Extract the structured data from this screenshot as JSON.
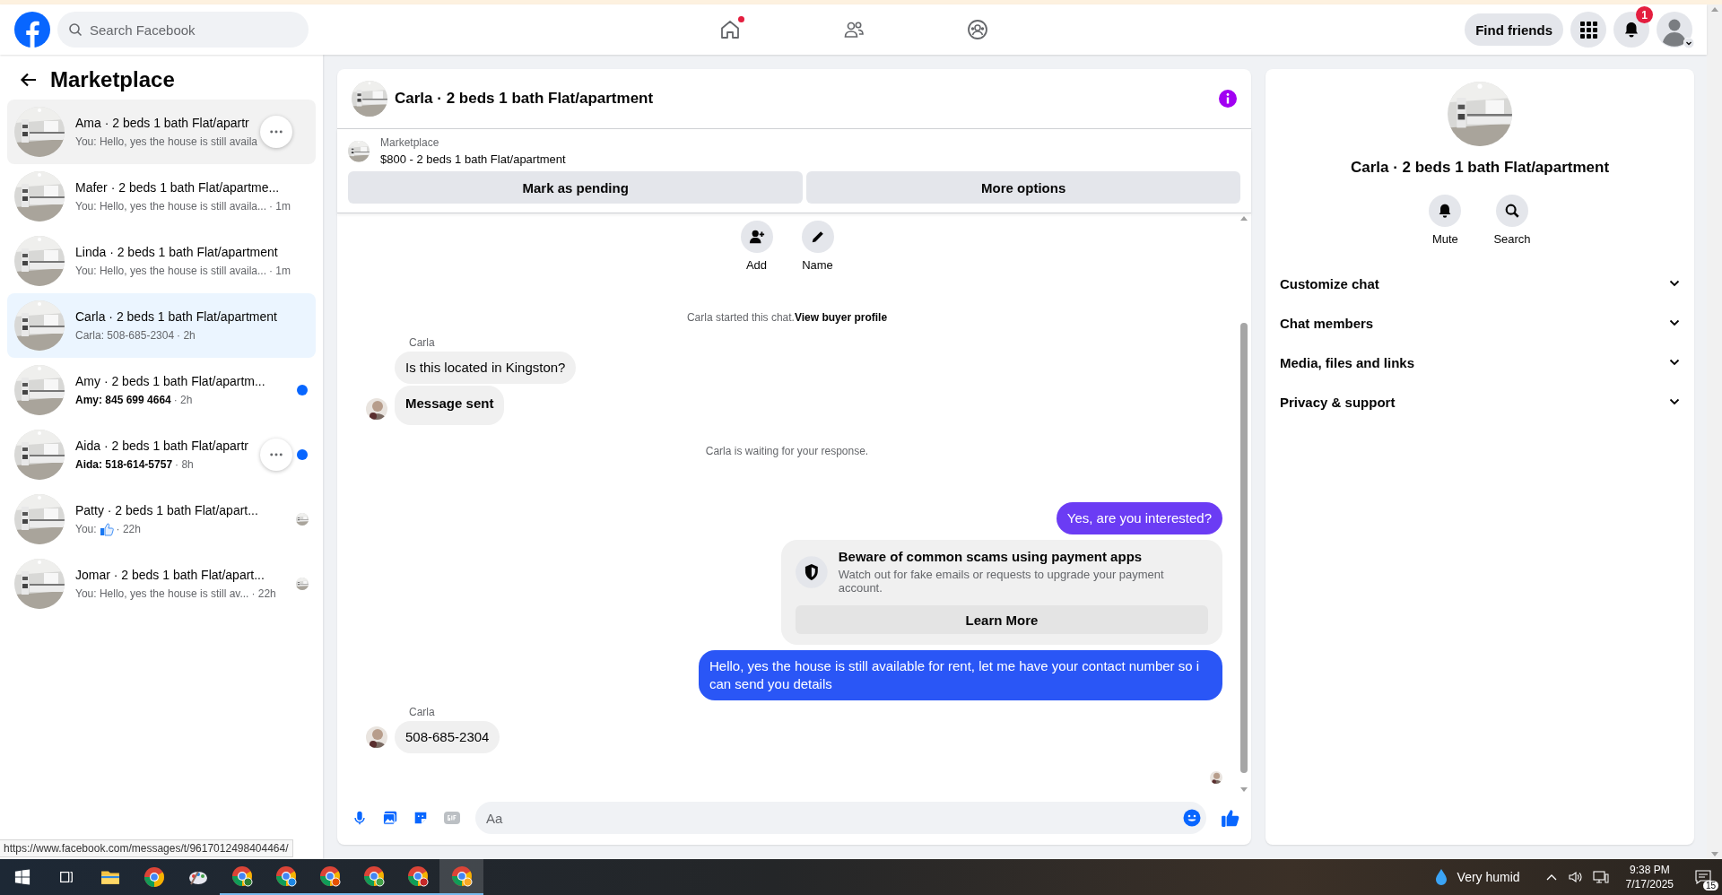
{
  "navbar": {
    "search": {
      "placeholder": "Search Facebook"
    },
    "nav_icons": [
      {
        "kind": "home",
        "notification_dot": true
      },
      {
        "kind": "friends",
        "notification_dot": false
      },
      {
        "kind": "groups",
        "notification_dot": false
      }
    ],
    "find_friends": "Find friends",
    "notifications_badge": "1"
  },
  "sidebar": {
    "title": "Marketplace",
    "conversations": [
      {
        "title": "Ama · 2 beds 1 bath Flat/apartr",
        "preview": "You: Hello, yes the house is still availa",
        "selected": false,
        "hovered": true,
        "unread": false,
        "more_button": true,
        "seen": false,
        "like_icon": false
      },
      {
        "title": "Mafer · 2 beds 1 bath Flat/apartme...",
        "preview": "You: Hello, yes the house is still availa...",
        "time": "· 1m",
        "selected": false,
        "hovered": false,
        "unread": false,
        "more_button": false,
        "seen": false,
        "like_icon": false
      },
      {
        "title": "Linda · 2 beds 1 bath Flat/apartment",
        "preview": "You: Hello, yes the house is still availa...",
        "time": "· 1m",
        "selected": false,
        "hovered": false,
        "unread": false,
        "more_button": false,
        "seen": false,
        "like_icon": false
      },
      {
        "title": "Carla · 2 beds 1 bath Flat/apartment",
        "preview": "Carla: 508-685-2304",
        "time": "· 2h",
        "selected": true,
        "hovered": false,
        "unread": false,
        "more_button": false,
        "seen": false,
        "like_icon": false
      },
      {
        "title": "Amy · 2 beds 1 bath Flat/apartm...",
        "preview": "Amy: 845 699 4664",
        "time": "· 2h",
        "selected": false,
        "hovered": false,
        "unread": true,
        "more_button": false,
        "seen": false,
        "like_icon": false
      },
      {
        "title": "Aida · 2 beds 1 bath Flat/apartr",
        "preview": "Aida: 518-614-5757",
        "time": "· 8h",
        "selected": false,
        "hovered": false,
        "unread": true,
        "more_button": true,
        "seen": false,
        "like_icon": false
      },
      {
        "title": "Patty · 2 beds 1 bath Flat/apart...",
        "preview": "You:",
        "time": "· 22h",
        "selected": false,
        "hovered": false,
        "unread": false,
        "more_button": false,
        "seen": true,
        "like_icon": true
      },
      {
        "title": "Jomar · 2 beds 1 bath Flat/apart...",
        "preview": "You: Hello, yes the house is still av...",
        "time": "· 22h",
        "selected": false,
        "hovered": false,
        "unread": false,
        "more_button": false,
        "seen": true,
        "like_icon": false
      }
    ]
  },
  "chat": {
    "title": "Carla · 2 beds 1 bath Flat/apartment",
    "listing": {
      "label": "Marketplace",
      "description": "$800 - 2 beds 1 bath Flat/apartment"
    },
    "buttons": [
      "Mark as pending",
      "More options"
    ],
    "actions": [
      {
        "kind": "add",
        "label": "Add"
      },
      {
        "kind": "name",
        "label": "Name"
      }
    ],
    "messages": [
      {
        "kind": "system",
        "text": "Carla started this chat.",
        "link": "View buyer profile"
      },
      {
        "kind": "incoming",
        "sender": "Carla",
        "bubbles": [
          {
            "text": "Is this located in Kingston?",
            "bold": false
          },
          {
            "text": "Message sent",
            "bold": true
          }
        ]
      },
      {
        "kind": "system",
        "text": "Carla is waiting for your response."
      },
      {
        "kind": "outgoing",
        "text": "Yes, are you interested?",
        "color": "#6b3cf4"
      },
      {
        "kind": "notice",
        "title": "Beware of common scams using payment apps",
        "text": "Watch out for fake emails or requests to upgrade your payment account.",
        "button": "Learn More"
      },
      {
        "kind": "outgoing",
        "text": "Hello, yes the house is still available for rent, let me have your contact number so i can send you details",
        "color": "#2a56f6"
      },
      {
        "kind": "incoming",
        "sender": "Carla",
        "bubbles": [
          {
            "text": "508-685-2304",
            "bold": false
          }
        ]
      }
    ],
    "composer": {
      "placeholder": "Aa"
    }
  },
  "details": {
    "title": "Carla · 2 beds 1 bath Flat/apartment",
    "actions": [
      {
        "kind": "mute",
        "label": "Mute"
      },
      {
        "kind": "search",
        "label": "Search"
      }
    ],
    "sections": [
      {
        "label": "Customize chat",
        "expanded": false
      },
      {
        "label": "Chat members",
        "expanded": false
      },
      {
        "label": "Media, files and links",
        "expanded": false
      },
      {
        "label": "Privacy & support",
        "expanded": false
      }
    ]
  },
  "status_url": "https://www.facebook.com/messages/t/9617012498404464/",
  "taskbar": {
    "apps": [
      {
        "kind": "taskview",
        "open": false,
        "selected": false
      },
      {
        "kind": "explorer",
        "open": false,
        "selected": false
      },
      {
        "kind": "chrome",
        "open": false,
        "selected": false
      },
      {
        "kind": "paint",
        "open": false,
        "selected": false
      },
      {
        "kind": "chrome_profile",
        "color": "#2e7d32",
        "open": true,
        "selected": false
      },
      {
        "kind": "chrome_profile",
        "color": "#1e88e5",
        "open": true,
        "selected": false
      },
      {
        "kind": "chrome_profile",
        "color": "#e65100",
        "open": true,
        "selected": false
      },
      {
        "kind": "chrome_profile",
        "color": "#43a047",
        "open": true,
        "selected": false
      },
      {
        "kind": "chrome_profile",
        "color": "#c62828",
        "open": true,
        "selected": false
      },
      {
        "kind": "chrome_profile",
        "color": "#f9a825",
        "open": true,
        "selected": true
      }
    ],
    "weather": "Very humid",
    "time": "9:38 PM",
    "date": "7/17/2025",
    "notification_count": "15"
  }
}
